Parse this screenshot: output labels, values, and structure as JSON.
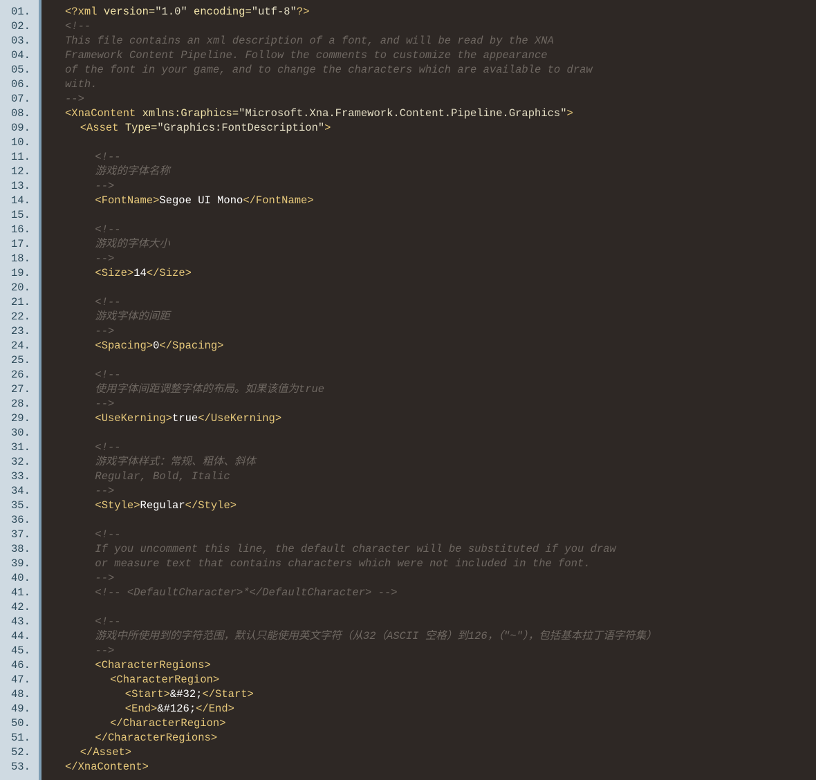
{
  "colors": {
    "gutter_background": "#cfdae2",
    "gutter_border": "#7f9fb5",
    "line_number": "#2d4a5a",
    "editor_background": "#2e2825",
    "tag": "#e6c87a",
    "attribute": "#f0e2a8",
    "attribute_value": "#e2dcc2",
    "text": "#ffffff",
    "comment": "#6e6761"
  },
  "lines": [
    {
      "num": "01.",
      "indent": 0,
      "tokens": [
        {
          "t": "tag",
          "v": "<?xml "
        },
        {
          "t": "attr",
          "v": "version="
        },
        {
          "t": "val",
          "v": "\"1.0\" "
        },
        {
          "t": "attr",
          "v": "encoding="
        },
        {
          "t": "val",
          "v": "\"utf-8\""
        },
        {
          "t": "tag",
          "v": "?>"
        }
      ]
    },
    {
      "num": "02.",
      "indent": 0,
      "tokens": [
        {
          "t": "cmt",
          "v": "<!--"
        }
      ]
    },
    {
      "num": "03.",
      "indent": 0,
      "tokens": [
        {
          "t": "cmt",
          "v": "This file contains an xml description of a font, and will be read by the XNA"
        }
      ]
    },
    {
      "num": "04.",
      "indent": 0,
      "tokens": [
        {
          "t": "cmt",
          "v": "Framework Content Pipeline. Follow the comments to customize the appearance"
        }
      ]
    },
    {
      "num": "05.",
      "indent": 0,
      "tokens": [
        {
          "t": "cmt",
          "v": "of the font in your game, and to change the characters which are available to draw"
        }
      ]
    },
    {
      "num": "06.",
      "indent": 0,
      "tokens": [
        {
          "t": "cmt",
          "v": "with."
        }
      ]
    },
    {
      "num": "07.",
      "indent": 0,
      "tokens": [
        {
          "t": "cmt",
          "v": "-->"
        }
      ]
    },
    {
      "num": "08.",
      "indent": 0,
      "tokens": [
        {
          "t": "tag",
          "v": "<XnaContent "
        },
        {
          "t": "attr",
          "v": "xmlns:Graphics="
        },
        {
          "t": "val",
          "v": "\"Microsoft.Xna.Framework.Content.Pipeline.Graphics\""
        },
        {
          "t": "tag",
          "v": ">"
        }
      ]
    },
    {
      "num": "09.",
      "indent": 1,
      "tokens": [
        {
          "t": "tag",
          "v": "<Asset "
        },
        {
          "t": "attr",
          "v": "Type="
        },
        {
          "t": "val",
          "v": "\"Graphics:FontDescription\""
        },
        {
          "t": "tag",
          "v": ">"
        }
      ]
    },
    {
      "num": "10.",
      "indent": 0,
      "tokens": []
    },
    {
      "num": "11.",
      "indent": 2,
      "tokens": [
        {
          "t": "cmt",
          "v": "<!--"
        }
      ]
    },
    {
      "num": "12.",
      "indent": 2,
      "tokens": [
        {
          "t": "cmt",
          "v": "游戏的字体名称"
        }
      ]
    },
    {
      "num": "13.",
      "indent": 2,
      "tokens": [
        {
          "t": "cmt",
          "v": "-->"
        }
      ]
    },
    {
      "num": "14.",
      "indent": 2,
      "tokens": [
        {
          "t": "tag",
          "v": "<FontName>"
        },
        {
          "t": "txt",
          "v": "Segoe UI Mono"
        },
        {
          "t": "tag",
          "v": "</FontName>"
        }
      ]
    },
    {
      "num": "15.",
      "indent": 0,
      "tokens": []
    },
    {
      "num": "16.",
      "indent": 2,
      "tokens": [
        {
          "t": "cmt",
          "v": "<!--"
        }
      ]
    },
    {
      "num": "17.",
      "indent": 2,
      "tokens": [
        {
          "t": "cmt",
          "v": "游戏的字体大小"
        }
      ]
    },
    {
      "num": "18.",
      "indent": 2,
      "tokens": [
        {
          "t": "cmt",
          "v": "-->"
        }
      ]
    },
    {
      "num": "19.",
      "indent": 2,
      "tokens": [
        {
          "t": "tag",
          "v": "<Size>"
        },
        {
          "t": "txt",
          "v": "14"
        },
        {
          "t": "tag",
          "v": "</Size>"
        }
      ]
    },
    {
      "num": "20.",
      "indent": 0,
      "tokens": []
    },
    {
      "num": "21.",
      "indent": 2,
      "tokens": [
        {
          "t": "cmt",
          "v": "<!--"
        }
      ]
    },
    {
      "num": "22.",
      "indent": 2,
      "tokens": [
        {
          "t": "cmt",
          "v": "游戏字体的间距"
        }
      ]
    },
    {
      "num": "23.",
      "indent": 2,
      "tokens": [
        {
          "t": "cmt",
          "v": "-->"
        }
      ]
    },
    {
      "num": "24.",
      "indent": 2,
      "tokens": [
        {
          "t": "tag",
          "v": "<Spacing>"
        },
        {
          "t": "txt",
          "v": "0"
        },
        {
          "t": "tag",
          "v": "</Spacing>"
        }
      ]
    },
    {
      "num": "25.",
      "indent": 0,
      "tokens": []
    },
    {
      "num": "26.",
      "indent": 2,
      "tokens": [
        {
          "t": "cmt",
          "v": "<!--"
        }
      ]
    },
    {
      "num": "27.",
      "indent": 2,
      "tokens": [
        {
          "t": "cmt",
          "v": "使用字体间距调整字体的布局。如果该值为true"
        }
      ]
    },
    {
      "num": "28.",
      "indent": 2,
      "tokens": [
        {
          "t": "cmt",
          "v": "-->"
        }
      ]
    },
    {
      "num": "29.",
      "indent": 2,
      "tokens": [
        {
          "t": "tag",
          "v": "<UseKerning>"
        },
        {
          "t": "txt",
          "v": "true"
        },
        {
          "t": "tag",
          "v": "</UseKerning>"
        }
      ]
    },
    {
      "num": "30.",
      "indent": 0,
      "tokens": []
    },
    {
      "num": "31.",
      "indent": 2,
      "tokens": [
        {
          "t": "cmt",
          "v": "<!--"
        }
      ]
    },
    {
      "num": "32.",
      "indent": 2,
      "tokens": [
        {
          "t": "cmt",
          "v": "游戏字体样式：常规、粗体、斜体"
        }
      ]
    },
    {
      "num": "33.",
      "indent": 2,
      "tokens": [
        {
          "t": "cmt",
          "v": "Regular, Bold, Italic"
        }
      ]
    },
    {
      "num": "34.",
      "indent": 2,
      "tokens": [
        {
          "t": "cmt",
          "v": "-->"
        }
      ]
    },
    {
      "num": "35.",
      "indent": 2,
      "tokens": [
        {
          "t": "tag",
          "v": "<Style>"
        },
        {
          "t": "txt",
          "v": "Regular"
        },
        {
          "t": "tag",
          "v": "</Style>"
        }
      ]
    },
    {
      "num": "36.",
      "indent": 0,
      "tokens": []
    },
    {
      "num": "37.",
      "indent": 2,
      "tokens": [
        {
          "t": "cmt",
          "v": "<!--"
        }
      ]
    },
    {
      "num": "38.",
      "indent": 2,
      "tokens": [
        {
          "t": "cmt",
          "v": "If you uncomment this line, the default character will be substituted if you draw"
        }
      ]
    },
    {
      "num": "39.",
      "indent": 2,
      "tokens": [
        {
          "t": "cmt",
          "v": "or measure text that contains characters which were not included in the font."
        }
      ]
    },
    {
      "num": "40.",
      "indent": 2,
      "tokens": [
        {
          "t": "cmt",
          "v": "-->"
        }
      ]
    },
    {
      "num": "41.",
      "indent": 2,
      "tokens": [
        {
          "t": "cmt",
          "v": "<!-- <DefaultCharacter>*</DefaultCharacter> -->"
        }
      ]
    },
    {
      "num": "42.",
      "indent": 0,
      "tokens": []
    },
    {
      "num": "43.",
      "indent": 2,
      "tokens": [
        {
          "t": "cmt",
          "v": "<!--"
        }
      ]
    },
    {
      "num": "44.",
      "indent": 2,
      "tokens": [
        {
          "t": "cmt",
          "v": "游戏中所使用到的字符范围，默认只能使用英文字符（从32（ASCII 空格）到126，（\"~\"），包括基本拉丁语字符集）"
        }
      ]
    },
    {
      "num": "45.",
      "indent": 2,
      "tokens": [
        {
          "t": "cmt",
          "v": "-->"
        }
      ]
    },
    {
      "num": "46.",
      "indent": 2,
      "tokens": [
        {
          "t": "tag",
          "v": "<CharacterRegions>"
        }
      ]
    },
    {
      "num": "47.",
      "indent": 3,
      "tokens": [
        {
          "t": "tag",
          "v": "<CharacterRegion>"
        }
      ]
    },
    {
      "num": "48.",
      "indent": 4,
      "tokens": [
        {
          "t": "tag",
          "v": "<Start>"
        },
        {
          "t": "txt",
          "v": "&#32;"
        },
        {
          "t": "tag",
          "v": "</Start>"
        }
      ]
    },
    {
      "num": "49.",
      "indent": 4,
      "tokens": [
        {
          "t": "tag",
          "v": "<End>"
        },
        {
          "t": "txt",
          "v": "&#126;"
        },
        {
          "t": "tag",
          "v": "</End>"
        }
      ]
    },
    {
      "num": "50.",
      "indent": 3,
      "tokens": [
        {
          "t": "tag",
          "v": "</CharacterRegion>"
        }
      ]
    },
    {
      "num": "51.",
      "indent": 2,
      "tokens": [
        {
          "t": "tag",
          "v": "</CharacterRegions>"
        }
      ]
    },
    {
      "num": "52.",
      "indent": 1,
      "tokens": [
        {
          "t": "tag",
          "v": "</Asset>"
        }
      ]
    },
    {
      "num": "53.",
      "indent": 0,
      "tokens": [
        {
          "t": "tag",
          "v": "</XnaContent>"
        }
      ]
    }
  ]
}
